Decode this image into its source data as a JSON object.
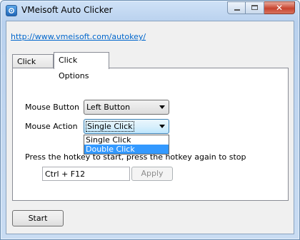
{
  "window": {
    "title": "VMeisoft Auto Clicker"
  },
  "link": {
    "url_text": "http://www.vmeisoft.com/autokey/"
  },
  "tabs": [
    {
      "label": "Click Point",
      "active": false
    },
    {
      "label": "Click Options",
      "active": true
    }
  ],
  "options": {
    "mouse_button_label": "Mouse Button",
    "mouse_button_value": "Left Button",
    "mouse_action_label": "Mouse Action",
    "mouse_action_value": "Single Click",
    "mouse_action_options": [
      "Single Click",
      "Double Click"
    ],
    "highlighted_option": "Double Click"
  },
  "hotkey": {
    "instruction": "Press the hotkey to start, press the hotkey again to stop",
    "value": "Ctrl + F12",
    "apply_label": "Apply",
    "apply_enabled": false
  },
  "footer": {
    "start_label": "Start"
  },
  "icons": {
    "app": "app-icon",
    "minimize": "minimize-icon",
    "maximize": "maximize-icon",
    "close": "close-icon",
    "dropdown": "chevron-down-icon"
  },
  "colors": {
    "link": "#0066cc",
    "selection": "#3399ff",
    "close_button": "#c7442f"
  }
}
